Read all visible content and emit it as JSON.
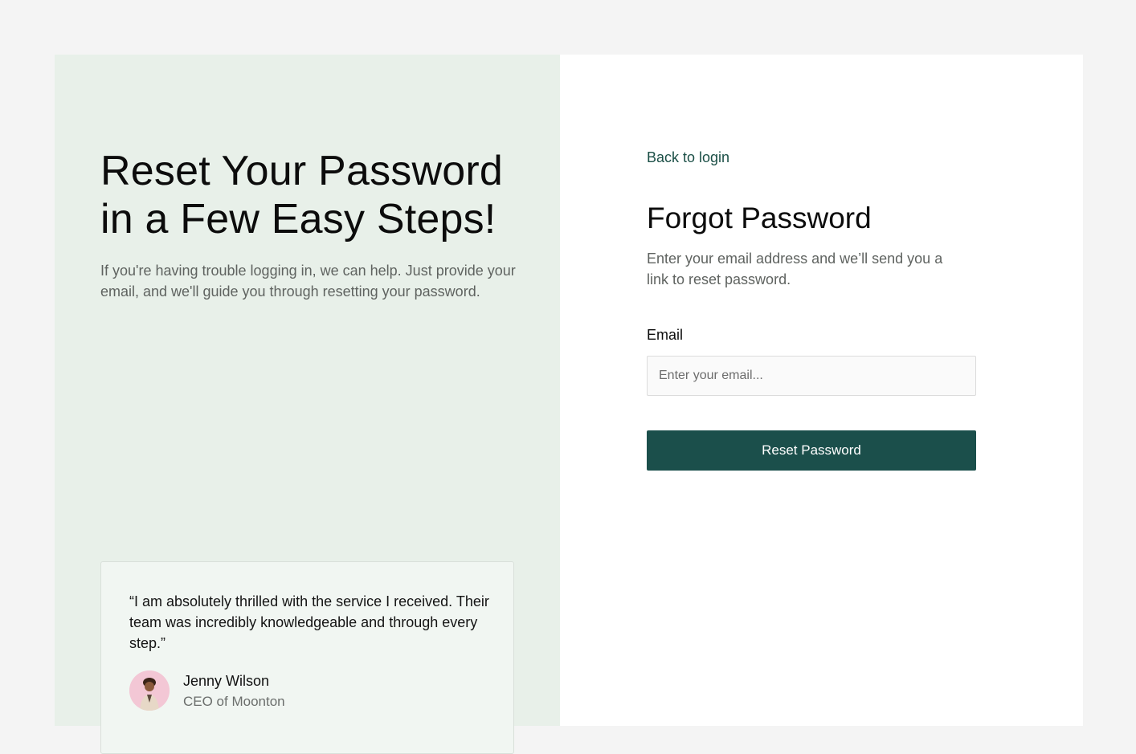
{
  "hero": {
    "title": "Reset Your Password in a Few Easy Steps!",
    "subtitle": "If you're having trouble logging in, we can help. Just provide your email, and we'll guide you through resetting your password."
  },
  "testimonial": {
    "quote": "“I am absolutely thrilled with the service I received. Their team was incredibly knowledgeable and through every step.”",
    "author_name": "Jenny Wilson",
    "author_role": "CEO of Moonton",
    "avatar_icon": "person-avatar"
  },
  "form": {
    "back_link": "Back to login",
    "title": "Forgot Password",
    "subtitle": "Enter your email address and we’ll send you a link to reset password.",
    "email_label": "Email",
    "email_placeholder": "Enter your email...",
    "email_value": "",
    "submit_label": "Reset Password"
  },
  "colors": {
    "page_background": "#f4f4f4",
    "left_panel": "#e8f0e9",
    "right_panel": "#ffffff",
    "accent": "#1b4f4b",
    "link": "#1b4f46",
    "avatar_background": "#f3c7d5"
  }
}
